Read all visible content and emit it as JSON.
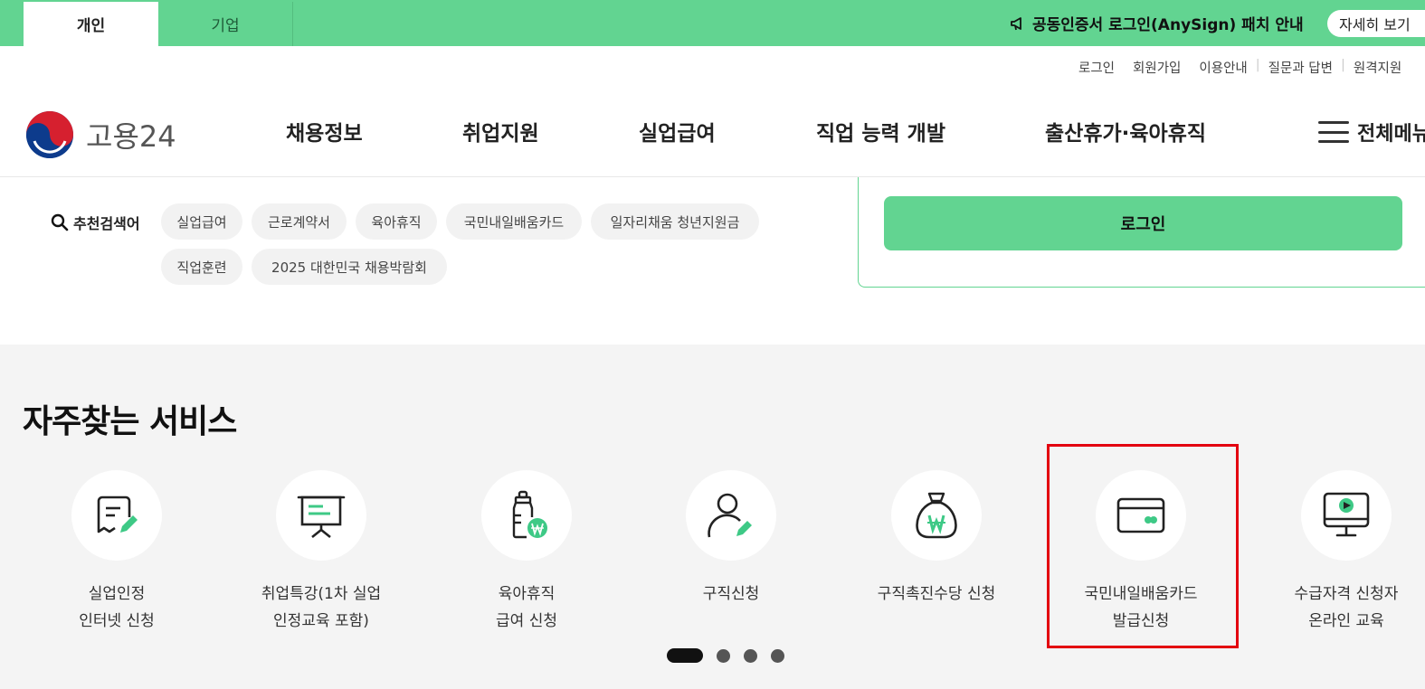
{
  "topbar": {
    "tabs": [
      "개인",
      "기업"
    ],
    "notice": "공동인증서 로그인(AnySign) 패치 안내",
    "more_label": "자세히 보기"
  },
  "utility_links": [
    "로그인",
    "회원가입",
    "이용안내",
    "질문과 답변",
    "원격지원"
  ],
  "logo_text": "고용24",
  "nav": [
    "채용정보",
    "취업지원",
    "실업급여",
    "직업 능력 개발",
    "출산휴가·육아휴직"
  ],
  "menu_all": "전체메뉴",
  "keywords": {
    "title": "추천검색어",
    "chips": [
      "실업급여",
      "근로계약서",
      "육아휴직",
      "국민내일배움카드",
      "일자리채움 청년지원금",
      "직업훈련",
      "2025 대한민국 채용박람회"
    ]
  },
  "login_button": "로그인",
  "services": {
    "title": "자주찾는 서비스",
    "items": [
      {
        "line1": "실업인정",
        "line2": "인터넷 신청",
        "icon": "document-pen-icon"
      },
      {
        "line1": "취업특강(1차 실업",
        "line2": "인정교육 포함)",
        "icon": "presentation-board-icon"
      },
      {
        "line1": "육아휴직",
        "line2": "급여 신청",
        "icon": "baby-bottle-won-icon"
      },
      {
        "line1": "구직신청",
        "line2": "",
        "icon": "person-pen-icon"
      },
      {
        "line1": "구직촉진수당 신청",
        "line2": "",
        "icon": "money-bag-won-icon"
      },
      {
        "line1": "국민내일배움카드",
        "line2": "발급신청",
        "icon": "credit-card-icon"
      },
      {
        "line1": "수급자격 신청자",
        "line2": "온라인 교육",
        "icon": "monitor-play-icon"
      }
    ]
  },
  "carousel": {
    "pages": 4,
    "current": 1
  },
  "colors": {
    "brand_green": "#62d491",
    "accent_green": "#3ec986",
    "highlight_red": "#e3000f"
  }
}
